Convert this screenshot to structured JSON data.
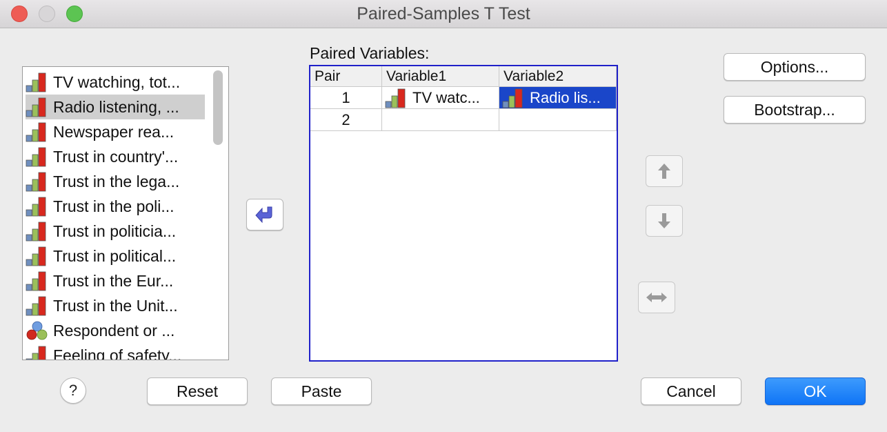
{
  "window": {
    "title": "Paired-Samples T Test"
  },
  "source_list": {
    "items": [
      {
        "label": "TV watching, tot...",
        "type": "scale",
        "selected": false
      },
      {
        "label": "Radio listening, ...",
        "type": "scale",
        "selected": true
      },
      {
        "label": "Newspaper rea...",
        "type": "scale",
        "selected": false
      },
      {
        "label": "Trust in country'...",
        "type": "scale",
        "selected": false
      },
      {
        "label": "Trust in the lega...",
        "type": "scale",
        "selected": false
      },
      {
        "label": "Trust in the poli...",
        "type": "scale",
        "selected": false
      },
      {
        "label": "Trust in politicia...",
        "type": "scale",
        "selected": false
      },
      {
        "label": "Trust in political...",
        "type": "scale",
        "selected": false
      },
      {
        "label": "Trust in the Eur...",
        "type": "scale",
        "selected": false
      },
      {
        "label": "Trust in the Unit...",
        "type": "scale",
        "selected": false
      },
      {
        "label": "Respondent or ...",
        "type": "nominal",
        "selected": false
      },
      {
        "label": "Feeling of safety...",
        "type": "scale",
        "selected": false
      }
    ]
  },
  "paired": {
    "label": "Paired Variables:",
    "headers": {
      "pair": "Pair",
      "var1": "Variable1",
      "var2": "Variable2"
    },
    "rows": [
      {
        "pair": "1",
        "var1": "TV watc...",
        "var2": "Radio lis...",
        "var1_icon": "scale-icon",
        "var2_icon": "scale-icon"
      },
      {
        "pair": "2",
        "var1": "",
        "var2": ""
      }
    ]
  },
  "buttons": {
    "options": "Options...",
    "bootstrap": "Bootstrap...",
    "reset": "Reset",
    "paste": "Paste",
    "cancel": "Cancel",
    "ok": "OK",
    "help": "?"
  },
  "icons": {
    "move": "move-back-arrow-icon",
    "up": "arrow-up-icon",
    "down": "arrow-down-icon",
    "swap": "swap-horizontal-icon"
  },
  "colors": {
    "accent": "#1a46c9",
    "ok_button": "#1a7ef8",
    "grid_border": "#1f20c9"
  }
}
